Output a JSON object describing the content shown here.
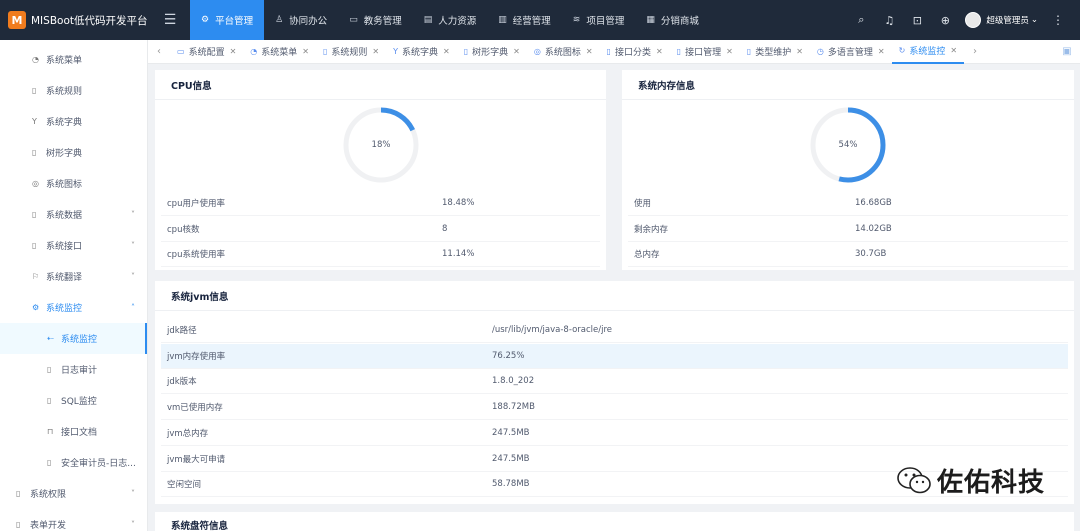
{
  "app": {
    "title": "MISBoot低代码开发平台",
    "logo_letter": "M",
    "brand_color": "#f07c1e"
  },
  "topnav": [
    {
      "label": "平台管理",
      "icon": "gear-icon",
      "active": true
    },
    {
      "label": "协同办公",
      "icon": "user-icon",
      "active": false
    },
    {
      "label": "教务管理",
      "icon": "monitor-icon",
      "active": false
    },
    {
      "label": "人力资源",
      "icon": "calendar-icon",
      "active": false
    },
    {
      "label": "经营管理",
      "icon": "bar-chart-icon",
      "active": false
    },
    {
      "label": "项目管理",
      "icon": "stack-icon",
      "active": false
    },
    {
      "label": "分销商城",
      "icon": "store-icon",
      "active": false
    }
  ],
  "user": {
    "name": "超级管理员"
  },
  "sidebar": {
    "items": [
      {
        "label": "系统菜单",
        "icon": "clock-icon"
      },
      {
        "label": "系统规则",
        "icon": "doc-icon"
      },
      {
        "label": "系统字典",
        "icon": "filter-icon"
      },
      {
        "label": "树形字典",
        "icon": "doc-icon"
      },
      {
        "label": "系统图标",
        "icon": "circle-icon"
      },
      {
        "label": "系统数据",
        "icon": "doc-icon",
        "arrow": "down"
      },
      {
        "label": "系统接口",
        "icon": "doc-icon",
        "arrow": "down"
      },
      {
        "label": "系统翻译",
        "icon": "translate-icon",
        "arrow": "down"
      },
      {
        "label": "系统监控",
        "icon": "gear-icon",
        "arrow": "up",
        "open": true
      },
      {
        "label": "系统监控",
        "icon": "arrow-left-icon",
        "sub": true,
        "active": true
      },
      {
        "label": "日志审计",
        "icon": "doc-icon",
        "sub": true
      },
      {
        "label": "SQL监控",
        "icon": "doc-icon",
        "sub": true
      },
      {
        "label": "接口文档",
        "icon": "window-icon",
        "sub": true
      },
      {
        "label": "安全审计员-日志...",
        "icon": "doc-icon",
        "sub": true
      },
      {
        "label": "系统权限",
        "icon": "doc-icon",
        "arrow": "down",
        "top": true
      },
      {
        "label": "表单开发",
        "icon": "doc-icon",
        "arrow": "down",
        "top": true
      }
    ]
  },
  "tabs": [
    {
      "label": "系统配置",
      "icon": "config-icon"
    },
    {
      "label": "系统菜单",
      "icon": "clock-icon"
    },
    {
      "label": "系统规则",
      "icon": "doc-icon"
    },
    {
      "label": "系统字典",
      "icon": "filter-icon"
    },
    {
      "label": "树形字典",
      "icon": "doc-icon"
    },
    {
      "label": "系统图标",
      "icon": "circle-icon"
    },
    {
      "label": "接口分类",
      "icon": "doc-icon"
    },
    {
      "label": "接口管理",
      "icon": "doc-icon"
    },
    {
      "label": "类型维护",
      "icon": "doc-icon"
    },
    {
      "label": "多语言管理",
      "icon": "globe-icon"
    },
    {
      "label": "系统监控",
      "icon": "refresh-icon",
      "active": true
    }
  ],
  "cpu": {
    "title": "CPU信息",
    "percent": 18,
    "percent_label": "18%",
    "rows": [
      {
        "key": "cpu用户使用率",
        "value": "18.48%"
      },
      {
        "key": "cpu核数",
        "value": "8"
      },
      {
        "key": "cpu系统使用率",
        "value": "11.14%"
      }
    ]
  },
  "memory": {
    "title": "系统内存信息",
    "percent": 54,
    "percent_label": "54%",
    "rows": [
      {
        "key": "使用",
        "value": "16.68GB"
      },
      {
        "key": "剩余内存",
        "value": "14.02GB"
      },
      {
        "key": "总内存",
        "value": "30.7GB"
      }
    ]
  },
  "jvm": {
    "title": "系统jvm信息",
    "rows": [
      {
        "key": "jdk路径",
        "value": "/usr/lib/jvm/java-8-oracle/jre"
      },
      {
        "key": "jvm内存使用率",
        "value": "76.25%",
        "highlight": true
      },
      {
        "key": "jdk版本",
        "value": "1.8.0_202"
      },
      {
        "key": "vm已使用内存",
        "value": "188.72MB"
      },
      {
        "key": "jvm总内存",
        "value": "247.5MB"
      },
      {
        "key": "jvm最大可申请",
        "value": "247.5MB"
      },
      {
        "key": "空闲空间",
        "value": "58.78MB"
      }
    ]
  },
  "disk": {
    "title": "系统盘符信息"
  },
  "watermark": {
    "text": "佐佑科技"
  },
  "colors": {
    "accent": "#2d8cf0",
    "topbar": "#1f2a3a",
    "donut": "#3d8fe6"
  }
}
